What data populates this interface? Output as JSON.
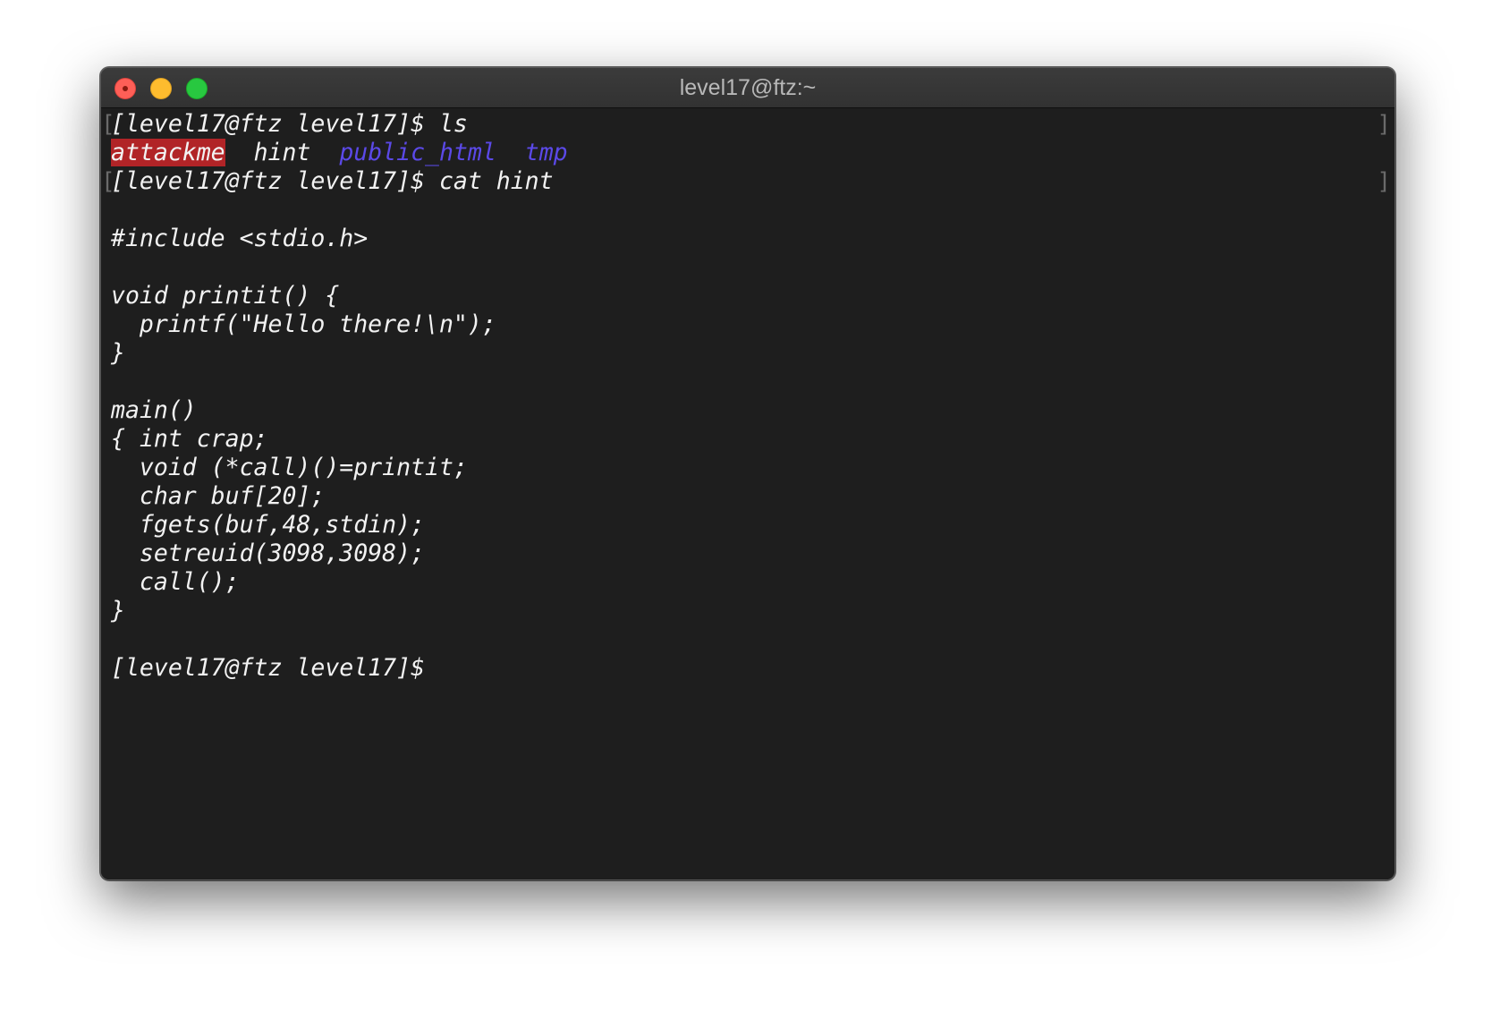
{
  "window": {
    "title": "level17@ftz:~"
  },
  "terminal": {
    "prompt": "[level17@ftz level17]$",
    "cmd1": " ls",
    "ls": {
      "exec": "attackme",
      "file": "hint",
      "dir1": "public_html",
      "dir2": "tmp"
    },
    "cmd2": " cat hint",
    "code": [
      "#include <stdio.h>",
      "void printit() {",
      "  printf(\"Hello there!\\n\");",
      "}",
      "main()",
      "{ int crap;",
      "  void (*call)()=printit;",
      "  char buf[20];",
      "  fgets(buf,48,stdin);",
      "  setreuid(3098,3098);",
      "  call();",
      "}"
    ],
    "mark_open": "[",
    "mark_close": "]"
  },
  "colors": {
    "background": "#1e1e1e",
    "text": "#f2f2f2",
    "executable_bg": "#b12427",
    "directory": "#5b49e8"
  }
}
